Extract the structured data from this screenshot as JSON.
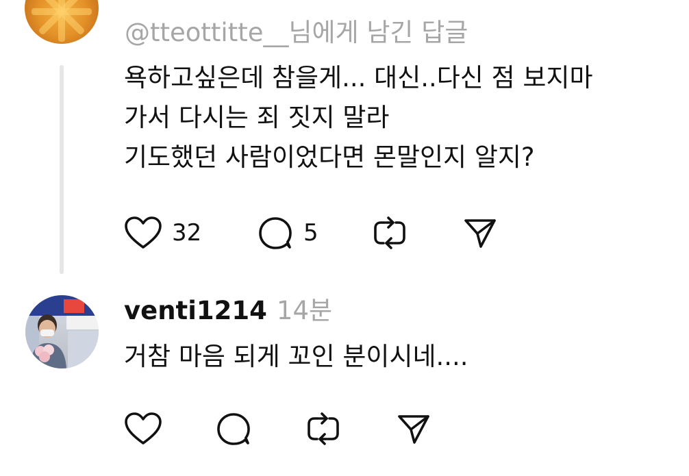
{
  "thread": {
    "post1": {
      "avatar_icon": "orange-avatar-icon",
      "reply_to": "@tteottitte__님에게 남긴 답글",
      "text_lines": [
        "욕하고싶은데 참을게... 대신..다신 점 보지마",
        "가서 다시는 죄 짓지 말라",
        "기도했던 사람이었다면 몬말인지 알지?"
      ],
      "actions": {
        "like_count": "32",
        "reply_count": "5"
      }
    },
    "post2": {
      "avatar_icon": "user-photo-avatar-icon",
      "username": "venti1214",
      "timestamp": "14분",
      "text_lines": [
        "거참 마음 되게 꼬인 분이시네...."
      ]
    }
  },
  "icons": {
    "like": "heart-icon",
    "reply": "comment-bubble-icon",
    "repost": "repost-icon",
    "share": "send-icon"
  },
  "colors": {
    "text": "#111111",
    "muted": "#a6a6a6",
    "thread_line": "#e6e6e6",
    "background": "#ffffff"
  }
}
